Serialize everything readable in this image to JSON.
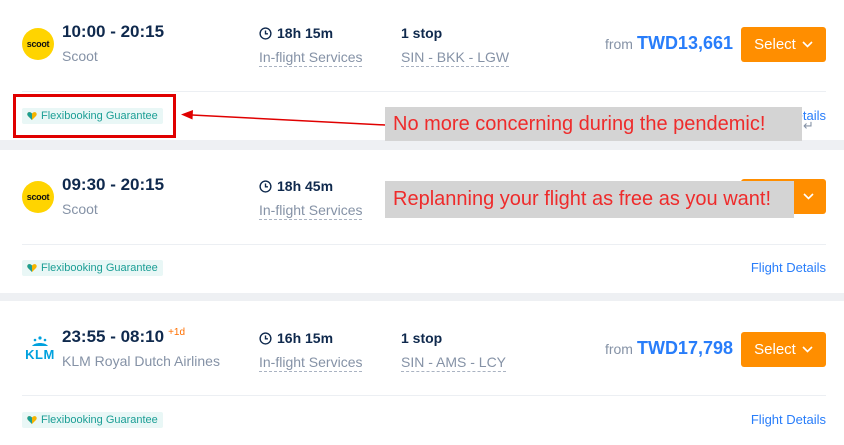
{
  "flights": [
    {
      "depart_arrive": "10:00 - 20:15",
      "day_offset": "",
      "airline": "Scoot",
      "logo_text": "scoot",
      "duration": "18h 15m",
      "services": "In-flight Services",
      "stops": "1 stop",
      "route": "SIN - BKK - LGW",
      "price_prefix": "from",
      "price": "TWD13,661",
      "select_label": "Select",
      "badge": "Flexibooking Guarantee",
      "details": "Flight Details"
    },
    {
      "depart_arrive": "09:30 - 20:15",
      "day_offset": "",
      "airline": "Scoot",
      "logo_text": "scoot",
      "duration": "18h 45m",
      "services": "In-flight Services",
      "badge": "Flexibooking Guarantee",
      "details": "Flight Details"
    },
    {
      "depart_arrive": "23:55 - 08:10",
      "day_offset": "+1d",
      "airline": "KLM Royal Dutch Airlines",
      "logo_text": "KLM",
      "duration": "16h 15m",
      "services": "In-flight Services",
      "stops": "1 stop",
      "route": "SIN - AMS - LCY",
      "price_prefix": "from",
      "price": "TWD17,798",
      "select_label": "Select",
      "badge": "Flexibooking Guarantee",
      "details": "Flight Details"
    }
  ],
  "partial_details": "etails",
  "annotations": {
    "first": "No more concerning during the pendemic!",
    "second": "Replanning your flight as free as you want!"
  },
  "colors": {
    "accent": "#ff8e00",
    "price": "#287dfa",
    "badge_text": "#1b9e95",
    "annotation_text": "#ee2b2b",
    "highlight_box": "#e00000"
  }
}
